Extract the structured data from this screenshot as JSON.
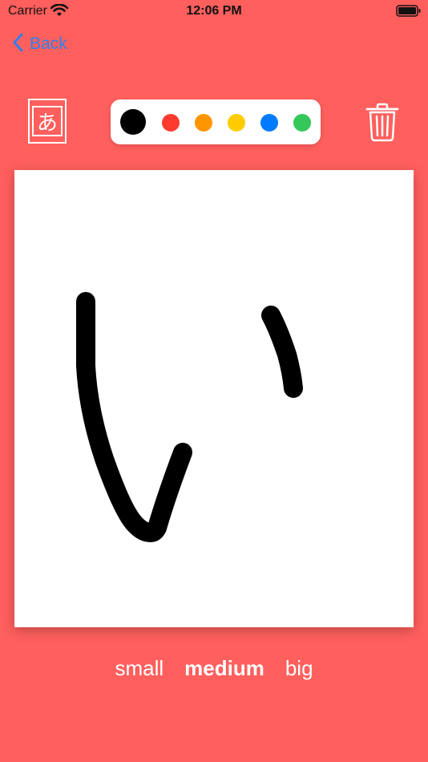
{
  "status_bar": {
    "carrier": "Carrier",
    "time": "12:06 PM",
    "wifi_icon": "wifi-icon",
    "battery_icon": "battery-icon"
  },
  "nav": {
    "back_label": "Back",
    "back_icon": "chevron-left-icon"
  },
  "toolbar": {
    "kana_label": "あ",
    "trash_icon": "trash-icon",
    "colors": [
      {
        "name": "black",
        "hex": "#000000",
        "selected": true
      },
      {
        "name": "red",
        "hex": "#FF3B30",
        "selected": false
      },
      {
        "name": "orange",
        "hex": "#FF9500",
        "selected": false
      },
      {
        "name": "yellow",
        "hex": "#FFCC00",
        "selected": false
      },
      {
        "name": "blue",
        "hex": "#007AFF",
        "selected": false
      },
      {
        "name": "green",
        "hex": "#34C759",
        "selected": false
      }
    ]
  },
  "brush_sizes": {
    "small": "small",
    "medium": "medium",
    "big": "big",
    "selected": "medium"
  },
  "theme": {
    "background": "#FF5F5D",
    "accent": "#2F80ED"
  }
}
